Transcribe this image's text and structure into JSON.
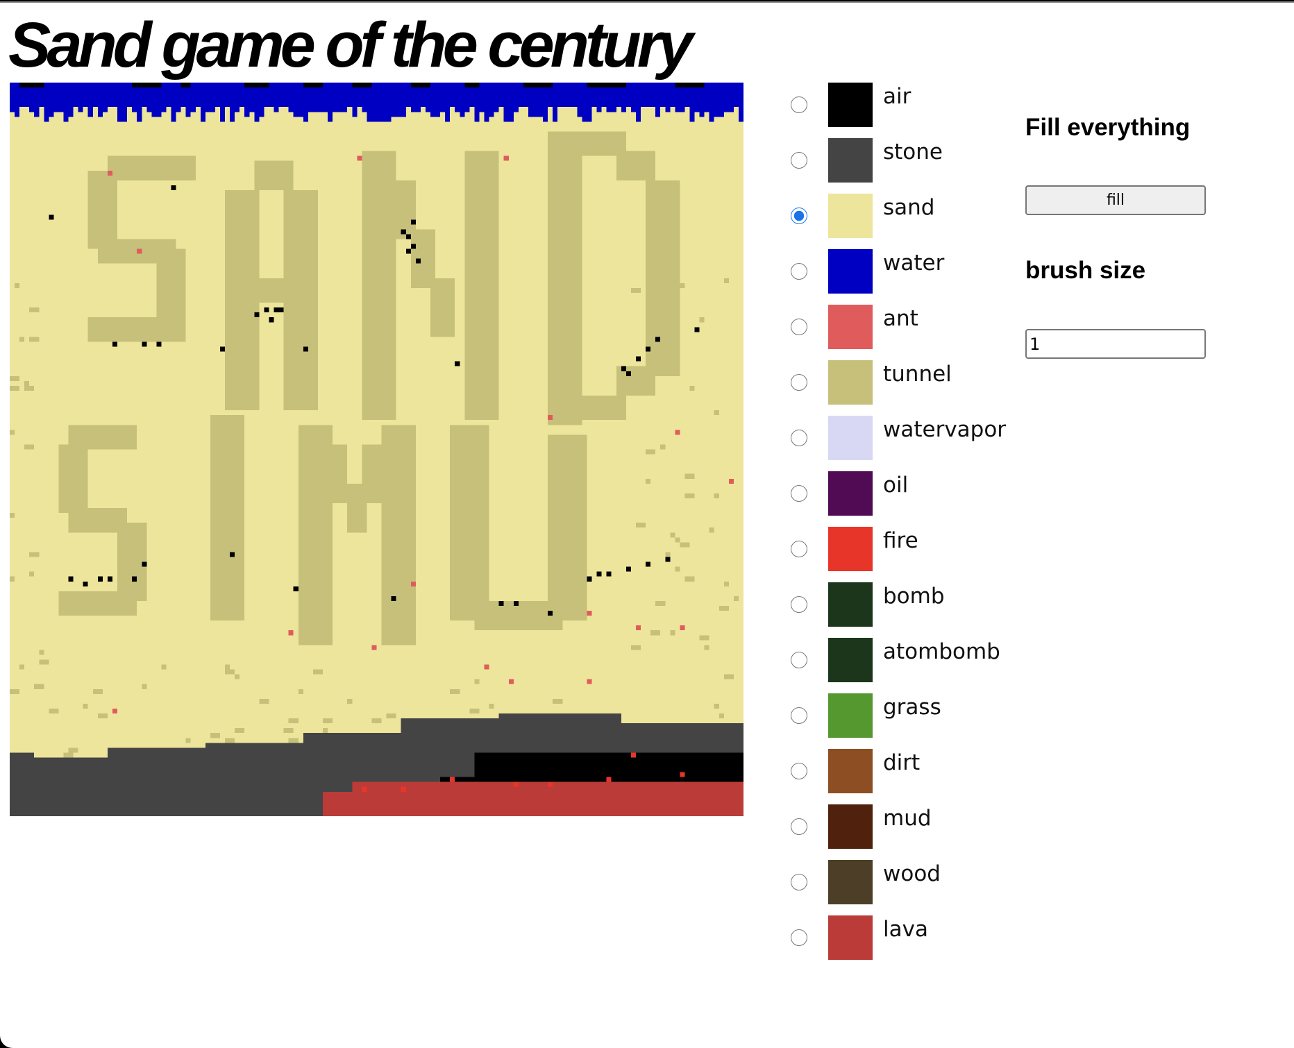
{
  "title": "Sand game of the century",
  "elements": [
    {
      "label": "air",
      "color": "#000000"
    },
    {
      "label": "stone",
      "color": "#444444"
    },
    {
      "label": "sand",
      "color": "#ede59b"
    },
    {
      "label": "water",
      "color": "#0000c2"
    },
    {
      "label": "ant",
      "color": "#e05c5c"
    },
    {
      "label": "tunnel",
      "color": "#c6c07a"
    },
    {
      "label": "watervapor",
      "color": "#d8d8f5"
    },
    {
      "label": "oil",
      "color": "#510b54"
    },
    {
      "label": "fire",
      "color": "#e8352a"
    },
    {
      "label": "bomb",
      "color": "#1b361b"
    },
    {
      "label": "atombomb",
      "color": "#1b361b"
    },
    {
      "label": "grass",
      "color": "#55982f"
    },
    {
      "label": "dirt",
      "color": "#8c4e22"
    },
    {
      "label": "mud",
      "color": "#50210c"
    },
    {
      "label": "wood",
      "color": "#4d3e28"
    },
    {
      "label": "lava",
      "color": "#bb3b38"
    }
  ],
  "selected_element": "sand",
  "fill": {
    "heading": "Fill everything",
    "button_label": "fill"
  },
  "brush": {
    "heading": "brush size",
    "value": "1"
  },
  "colors": {
    "radio_accent": "#1a73e8"
  }
}
